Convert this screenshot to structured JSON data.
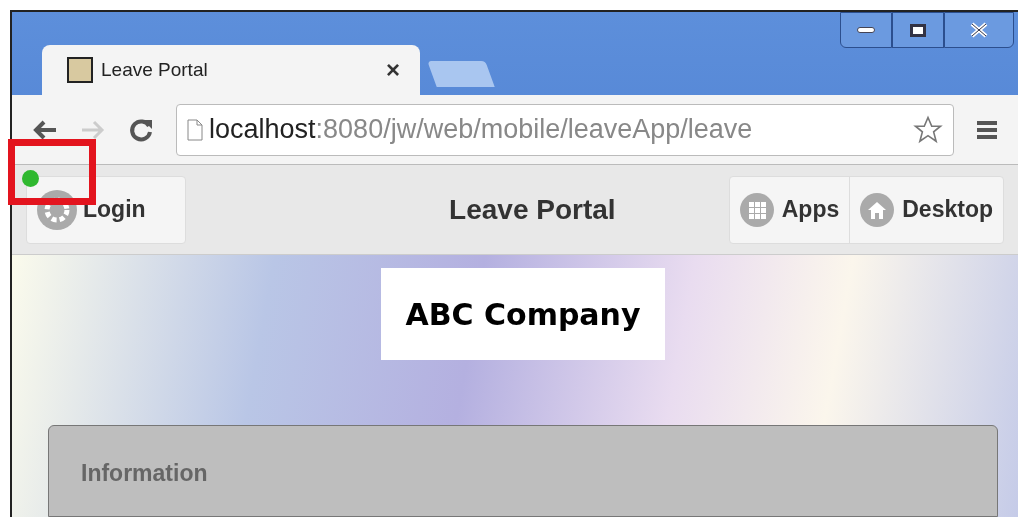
{
  "browser": {
    "tab": {
      "title": "Leave Portal",
      "close": "×"
    },
    "address": {
      "host": "localhost",
      "path": ":8080/jw/web/mobile/leaveApp/leave"
    }
  },
  "app_bar": {
    "title": "Leave Portal",
    "left_button": {
      "label": "Login"
    },
    "right_buttons": [
      {
        "label": "Apps",
        "kind": "grid"
      },
      {
        "label": "Desktop",
        "kind": "home"
      }
    ]
  },
  "status_dot": {
    "color": "#2fb82f"
  },
  "logo": {
    "text": "ABC Company"
  },
  "panel": {
    "title": "Information"
  }
}
